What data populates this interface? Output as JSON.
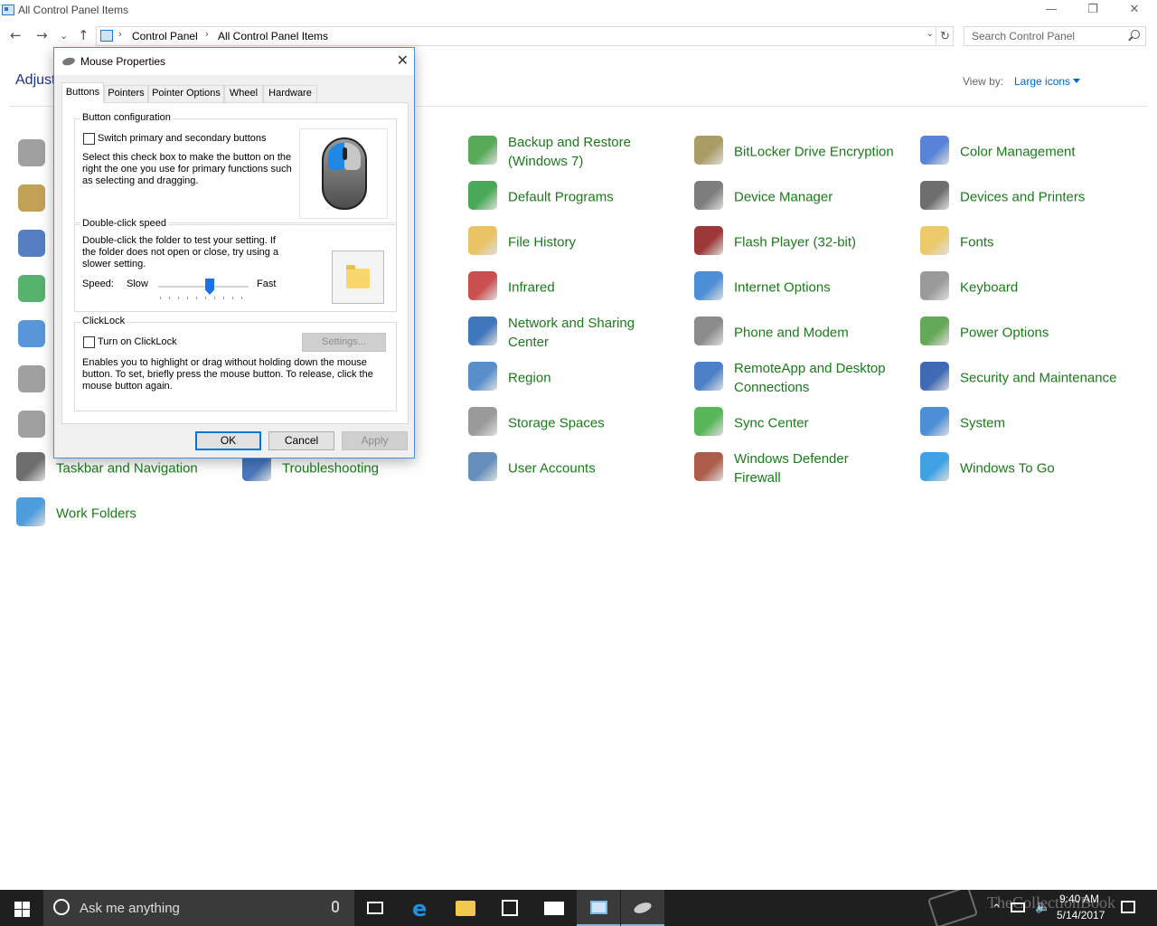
{
  "window": {
    "title": "All Control Panel Items",
    "minimize": "—",
    "restore": "❐",
    "close": "✕"
  },
  "nav": {
    "back": "←",
    "forward": "→",
    "recent": "⌄",
    "up": "↑"
  },
  "address": {
    "crumbs": [
      "Control Panel",
      "All Control Panel Items"
    ],
    "separator": "›",
    "dropdown": "⌄",
    "refresh": "↻"
  },
  "search": {
    "placeholder": "Search Control Panel"
  },
  "header": {
    "adjust_text": "Adjust",
    "view_by_label": "View by:",
    "view_by_value": "Large icons"
  },
  "items": [
    {
      "label": "Backup and Restore\n(Windows 7)",
      "icon": "backup-icon",
      "color": "#3a9b3a"
    },
    {
      "label": "BitLocker Drive Encryption",
      "icon": "bitlocker-icon",
      "color": "#9a8a4a"
    },
    {
      "label": "Color Management",
      "icon": "color-management-icon",
      "color": "#3b6fd1"
    },
    {
      "label": "Default Programs",
      "icon": "default-programs-icon",
      "color": "#2a9a3a"
    },
    {
      "label": "Device Manager",
      "icon": "device-manager-icon",
      "color": "#666666"
    },
    {
      "label": "Devices and Printers",
      "icon": "devices-printers-icon",
      "color": "#555555"
    },
    {
      "label": "File History",
      "icon": "file-history-icon",
      "color": "#e6b84a"
    },
    {
      "label": "Flash Player (32-bit)",
      "icon": "flash-player-icon",
      "color": "#8a1515"
    },
    {
      "label": "Fonts",
      "icon": "fonts-icon",
      "color": "#e8c050"
    },
    {
      "label": "Infrared",
      "icon": "infrared-icon",
      "color": "#c03030"
    },
    {
      "label": "Internet Options",
      "icon": "internet-options-icon",
      "color": "#2e7bcf"
    },
    {
      "label": "Keyboard",
      "icon": "keyboard-icon",
      "color": "#888888"
    },
    {
      "label": "Network and Sharing\nCenter",
      "icon": "network-sharing-icon",
      "color": "#1f5fb0"
    },
    {
      "label": "Phone and Modem",
      "icon": "phone-modem-icon",
      "color": "#777777"
    },
    {
      "label": "Power Options",
      "icon": "power-options-icon",
      "color": "#4a9a3a"
    },
    {
      "label": "Region",
      "icon": "region-icon",
      "color": "#3a7ac0"
    },
    {
      "label": "RemoteApp and Desktop\nConnections",
      "icon": "remoteapp-icon",
      "color": "#2d6bbf"
    },
    {
      "label": "Security and Maintenance",
      "icon": "security-maintenance-icon",
      "color": "#1e4fa8"
    },
    {
      "label": "Storage Spaces",
      "icon": "storage-spaces-icon",
      "color": "#888888"
    },
    {
      "label": "Sync Center",
      "icon": "sync-center-icon",
      "color": "#3aa83a"
    },
    {
      "label": "System",
      "icon": "system-icon",
      "color": "#2e7bcf"
    },
    {
      "label": "Taskbar and Navigation",
      "icon": "taskbar-navigation-icon",
      "color": "#555555"
    },
    {
      "label": "Troubleshooting",
      "icon": "troubleshooting-icon",
      "color": "#2a5fb0"
    },
    {
      "label": "User Accounts",
      "icon": "user-accounts-icon",
      "color": "#4a7ab0"
    },
    {
      "label": "Windows Defender\nFirewall",
      "icon": "firewall-icon",
      "color": "#a0402a"
    },
    {
      "label": "Windows To Go",
      "icon": "windows-to-go-icon",
      "color": "#1e90e0"
    },
    {
      "label": "Work Folders",
      "icon": "work-folders-icon",
      "color": "#2e8bd6"
    }
  ],
  "left_icons": [
    {
      "icon": "admin-tools-icon",
      "color": "#888888"
    },
    {
      "icon": "autoplay-icon",
      "color": "#b08a2a"
    },
    {
      "icon": "ease-of-access-icon",
      "color": "#2a5fb0"
    },
    {
      "icon": "homegroup-icon",
      "color": "#2aa04a"
    },
    {
      "icon": "language-icon",
      "color": "#2e7bcf"
    },
    {
      "icon": "recovery-icon",
      "color": "#888888"
    },
    {
      "icon": "sound-icon",
      "color": "#888888"
    }
  ],
  "dialog": {
    "title": "Mouse Properties",
    "close": "✕",
    "tabs": [
      "Buttons",
      "Pointers",
      "Pointer Options",
      "Wheel",
      "Hardware"
    ],
    "active_tab": "Buttons",
    "button_config": {
      "title": "Button configuration",
      "checkbox_label": "Switch primary and secondary buttons",
      "checked": false,
      "description": "Select this check box to make the button on the right the one you use for primary functions such as selecting and dragging."
    },
    "double_click": {
      "title": "Double-click speed",
      "description": "Double-click the folder to test your setting. If the folder does not open or close, try using a slower setting.",
      "speed_label": "Speed:",
      "slow": "Slow",
      "fast": "Fast",
      "speed_fraction": 0.57
    },
    "clicklock": {
      "title": "ClickLock",
      "checkbox_label": "Turn on ClickLock",
      "checked": false,
      "settings_button": "Settings...",
      "description": "Enables you to highlight or drag without holding down the mouse button. To set, briefly press the mouse button. To release, click the mouse button again."
    },
    "buttons": {
      "ok": "OK",
      "cancel": "Cancel",
      "apply": "Apply"
    }
  },
  "taskbar": {
    "search_text": "Ask me anything",
    "time": "9:40 AM",
    "date": "5/14/2017",
    "watermark": "TheCollectionBook",
    "accent": "#76b9ed"
  }
}
